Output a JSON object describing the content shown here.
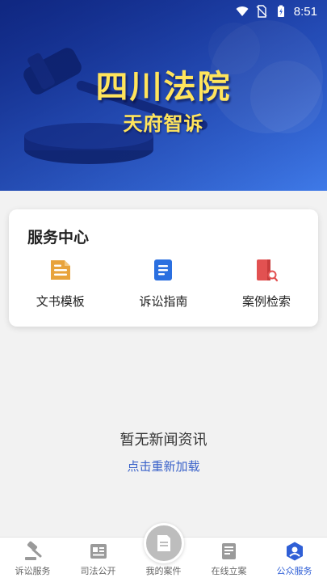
{
  "status_bar": {
    "time": "8:51",
    "icons": [
      "wifi-icon",
      "no-sim-icon",
      "battery-icon"
    ]
  },
  "banner": {
    "title": "四川法院",
    "subtitle": "天府智诉"
  },
  "service_center": {
    "title": "服务中心",
    "items": [
      {
        "label": "文书模板",
        "icon": "document-template-icon",
        "color": "#e8a33b"
      },
      {
        "label": "诉讼指南",
        "icon": "guide-book-icon",
        "color": "#2a6fe0"
      },
      {
        "label": "案例检索",
        "icon": "case-search-icon",
        "color": "#e25151"
      }
    ]
  },
  "news": {
    "empty_text": "暂无新闻资讯",
    "reload_label": "点击重新加载"
  },
  "tab_bar": {
    "active_index": 4,
    "active_color": "#2f5fd6",
    "tabs": [
      {
        "label": "诉讼服务",
        "icon": "gavel-icon"
      },
      {
        "label": "司法公开",
        "icon": "newspaper-icon"
      },
      {
        "label": "我的案件",
        "icon": "my-case-icon"
      },
      {
        "label": "在线立案",
        "icon": "filing-icon"
      },
      {
        "label": "公众服务",
        "icon": "public-service-icon"
      }
    ]
  }
}
